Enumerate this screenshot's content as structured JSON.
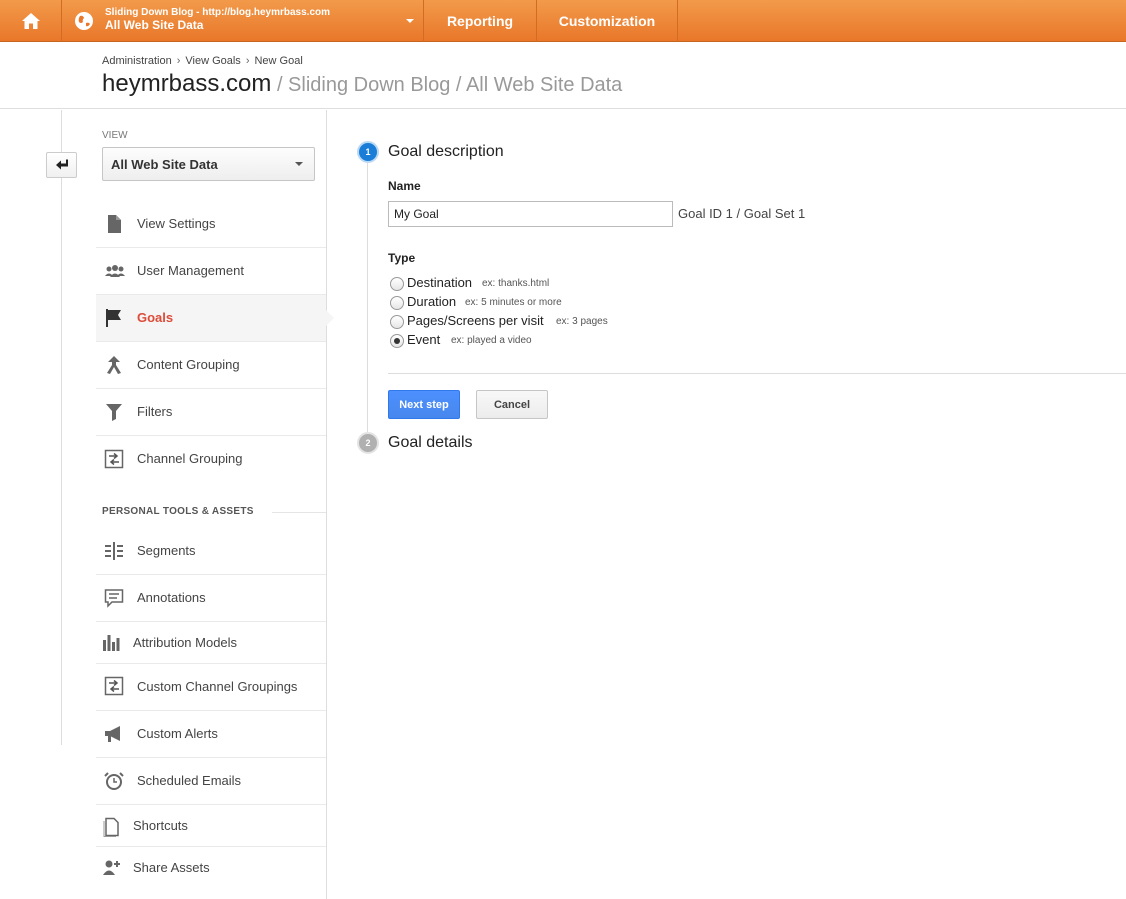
{
  "topbar": {
    "home_icon": "home-icon",
    "account_icon": "globe-icon",
    "account_line1": "Sliding Down Blog - http://blog.heymrbass.com",
    "account_line2": "All Web Site Data",
    "tabs": [
      "Reporting",
      "Customization"
    ],
    "accent_color": "#ef8a36"
  },
  "breadcrumb": [
    "Administration",
    "View Goals",
    "New Goal"
  ],
  "title": {
    "main": "heymrbass.com",
    "sub": " / Sliding Down Blog / All Web Site Data"
  },
  "sidebar": {
    "view_label": "VIEW",
    "view_selected": "All Web Site Data",
    "items": [
      {
        "label": "View Settings",
        "icon": "document-icon"
      },
      {
        "label": "User Management",
        "icon": "users-icon"
      },
      {
        "label": "Goals",
        "icon": "flag-icon",
        "active": true
      },
      {
        "label": "Content Grouping",
        "icon": "merge-arrow-icon"
      },
      {
        "label": "Filters",
        "icon": "funnel-icon"
      },
      {
        "label": "Channel Grouping",
        "icon": "channel-icon"
      }
    ],
    "section_heading": "PERSONAL TOOLS & ASSETS",
    "tools": [
      {
        "label": "Segments",
        "icon": "segments-icon"
      },
      {
        "label": "Annotations",
        "icon": "comment-icon"
      },
      {
        "label": "Attribution Models",
        "icon": "bar-chart-icon"
      },
      {
        "label": "Custom Channel Groupings",
        "icon": "channel-icon"
      },
      {
        "label": "Custom Alerts",
        "icon": "megaphone-icon"
      },
      {
        "label": "Scheduled Emails",
        "icon": "alarm-clock-icon"
      },
      {
        "label": "Shortcuts",
        "icon": "page-icon"
      },
      {
        "label": "Share Assets",
        "icon": "add-user-icon"
      }
    ],
    "active_color": "#dd4b39"
  },
  "main": {
    "step1": {
      "number": "1",
      "title": "Goal description"
    },
    "name_label": "Name",
    "name_value": "My Goal",
    "goal_id": "Goal ID 1 / Goal Set 1",
    "type_label": "Type",
    "types": [
      {
        "label": "Destination",
        "example": "ex: thanks.html",
        "checked": false
      },
      {
        "label": "Duration",
        "example": "ex: 5 minutes or more",
        "checked": false
      },
      {
        "label": "Pages/Screens per visit",
        "example": "ex: 3 pages",
        "checked": false
      },
      {
        "label": "Event",
        "example": "ex: played a video",
        "checked": true
      }
    ],
    "next_button": "Next step",
    "cancel_button": "Cancel",
    "step2": {
      "number": "2",
      "title": "Goal details"
    },
    "primary_color": "#4d90fe"
  }
}
